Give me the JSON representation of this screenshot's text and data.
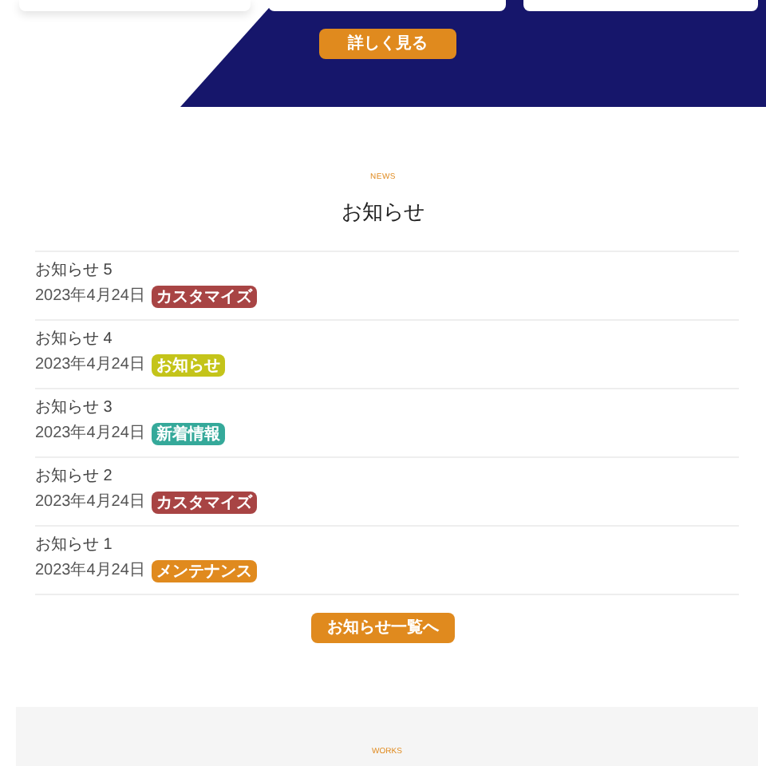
{
  "hero": {
    "button": "詳しく見る"
  },
  "news": {
    "eyebrow": "NEWS",
    "title": "お知らせ",
    "items": [
      {
        "title": "お知らせ 5",
        "date": "2023年4月24日",
        "tag": "カスタマイズ",
        "color": "#a84444"
      },
      {
        "title": "お知らせ 4",
        "date": "2023年4月24日",
        "tag": "お知らせ",
        "color": "#c4c41a"
      },
      {
        "title": "お知らせ 3",
        "date": "2023年4月24日",
        "tag": "新着情報",
        "color": "#35a99a"
      },
      {
        "title": "お知らせ 2",
        "date": "2023年4月24日",
        "tag": "カスタマイズ",
        "color": "#a84444"
      },
      {
        "title": "お知らせ 1",
        "date": "2023年4月24日",
        "tag": "メンテナンス",
        "color": "#e08a1e"
      }
    ],
    "button": "お知らせ一覧へ"
  },
  "works": {
    "eyebrow": "WORKS"
  }
}
